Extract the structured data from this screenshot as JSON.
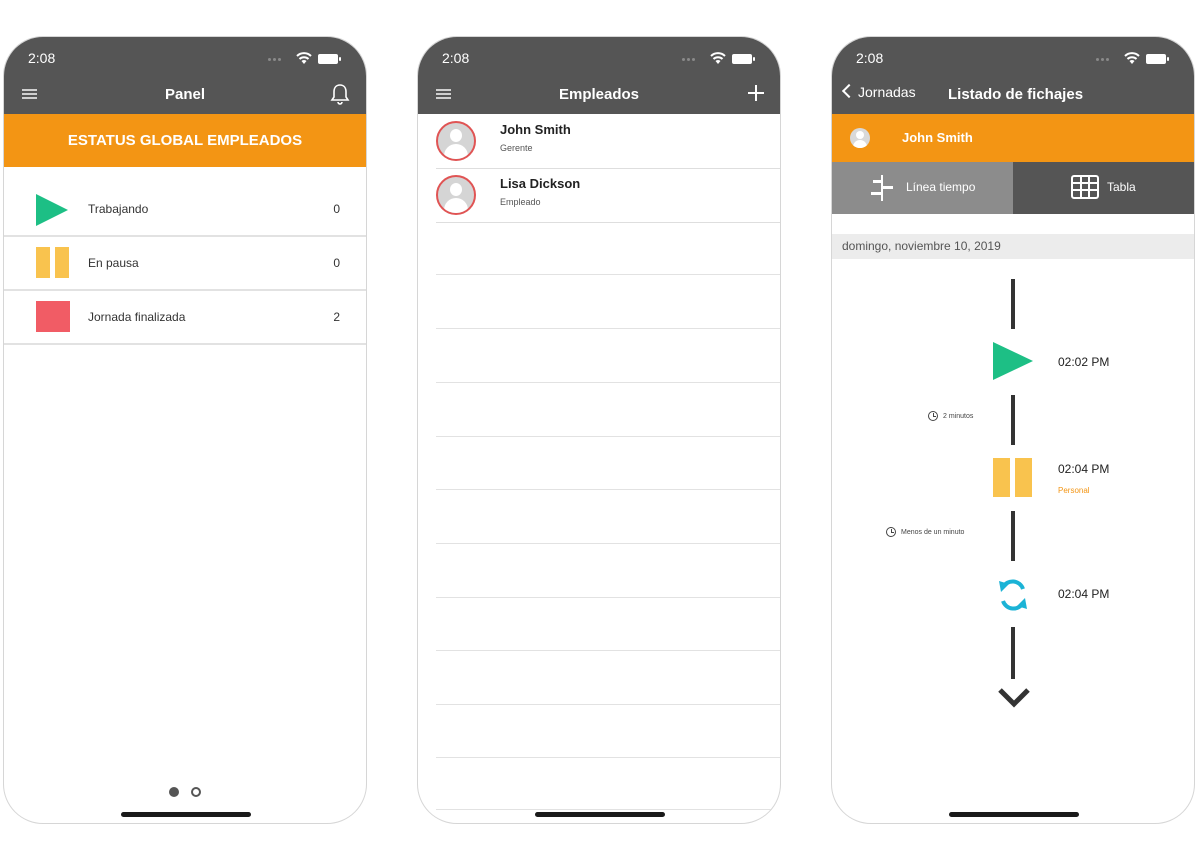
{
  "phone1": {
    "status_time": "2:08",
    "nav_title": "Panel",
    "banner": "ESTATUS GLOBAL EMPLEADOS",
    "rows": [
      {
        "label": "Trabajando",
        "count": "0",
        "color": "#1dbf85",
        "icon": "play-icon"
      },
      {
        "label": "En pausa",
        "count": "0",
        "color": "#f9c34e",
        "icon": "pause-icon"
      },
      {
        "label": "Jornada finalizada",
        "count": "2",
        "color": "#f15c65",
        "icon": "stop-icon"
      }
    ],
    "page_indicator": {
      "current": 1,
      "total": 2
    }
  },
  "phone2": {
    "status_time": "2:08",
    "nav_title": "Empleados",
    "employees": [
      {
        "name": "John Smith",
        "role": "Gerente"
      },
      {
        "name": "Lisa Dickson",
        "role": "Empleado"
      }
    ]
  },
  "phone3": {
    "status_time": "2:08",
    "back_label": "Jornadas",
    "nav_title": "Listado de fichajes",
    "user_name": "John Smith",
    "segments": [
      {
        "label": "Línea tiempo",
        "active": true,
        "icon": "timeline-icon"
      },
      {
        "label": "Tabla",
        "active": false,
        "icon": "table-icon"
      }
    ],
    "date": "domingo, noviembre 10, 2019",
    "events": [
      {
        "time": "02:02 PM",
        "type": "play",
        "note": ""
      },
      {
        "time": "02:04 PM",
        "type": "pause",
        "note": "Personal"
      },
      {
        "time": "02:04 PM",
        "type": "sync",
        "note": ""
      }
    ],
    "durations": [
      "2 minutos",
      "Menos de un minuto"
    ]
  },
  "colors": {
    "accent": "#f39514",
    "header": "#555555",
    "working": "#1dbf85",
    "paused": "#f9c34e",
    "finished": "#f15c65",
    "sync": "#1bb3d6"
  }
}
